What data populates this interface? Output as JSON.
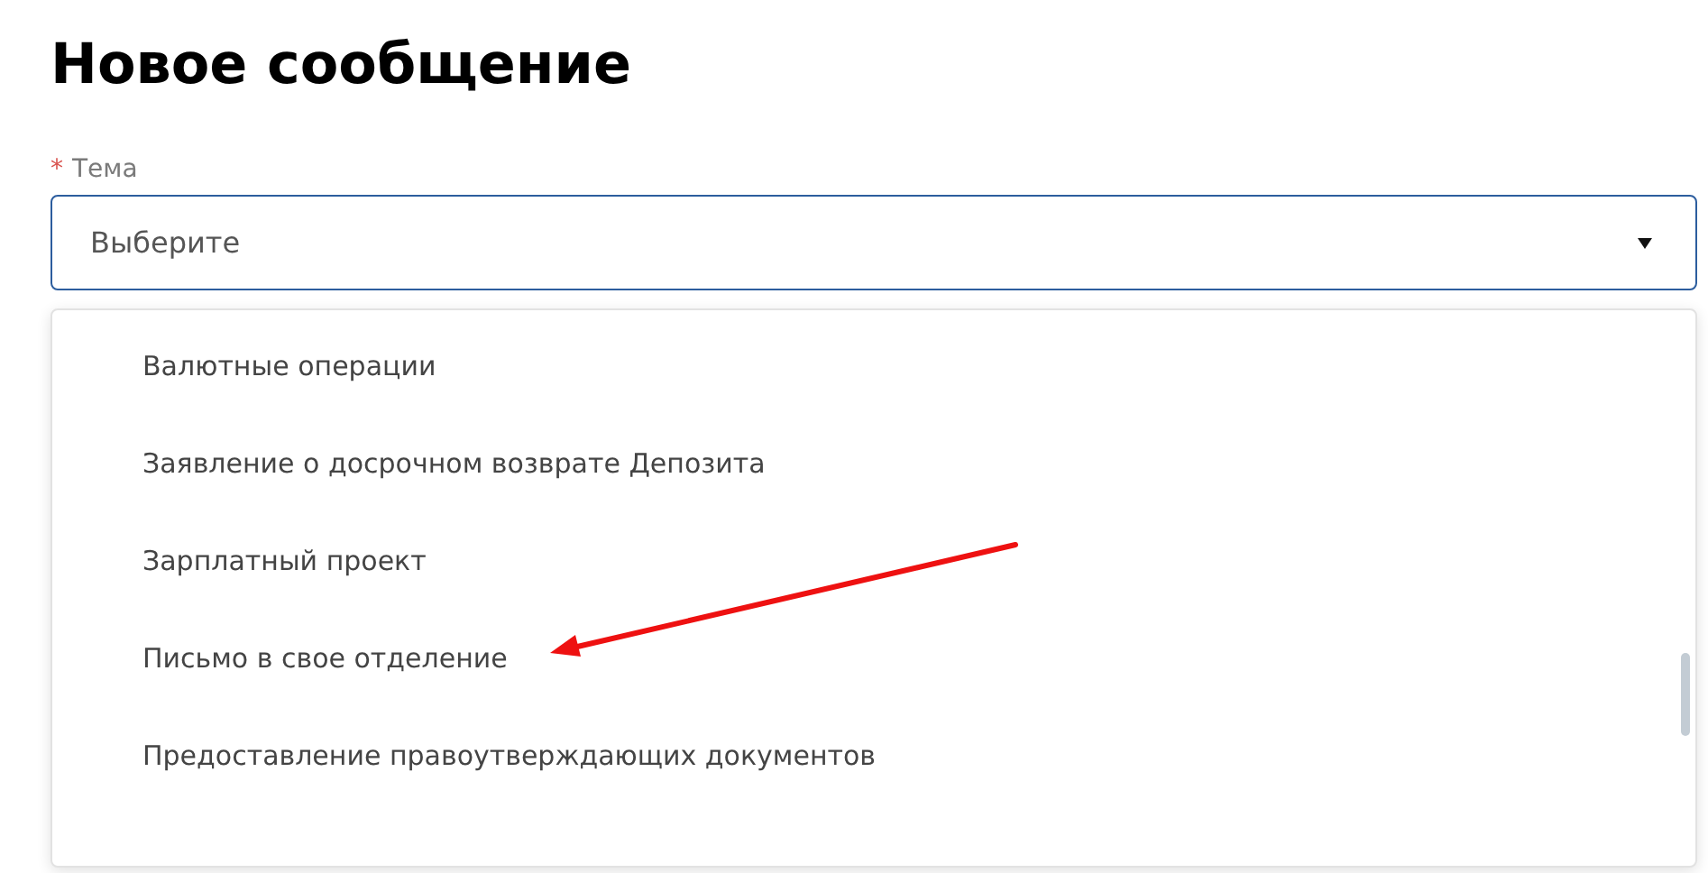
{
  "title": "Новое сообщение",
  "field": {
    "required_mark": "*",
    "label": "Тема",
    "placeholder": "Выберите",
    "expanded": true
  },
  "options": [
    {
      "label": "Валютные операции",
      "selected": false
    },
    {
      "label": "Заявление о досрочном возврате Депозита",
      "selected": false
    },
    {
      "label": "Зарплатный проект",
      "selected": false
    },
    {
      "label": "Письмо в свое отделение",
      "selected": false
    },
    {
      "label": "Предоставление правоутверждающих документов",
      "selected": false
    }
  ]
}
